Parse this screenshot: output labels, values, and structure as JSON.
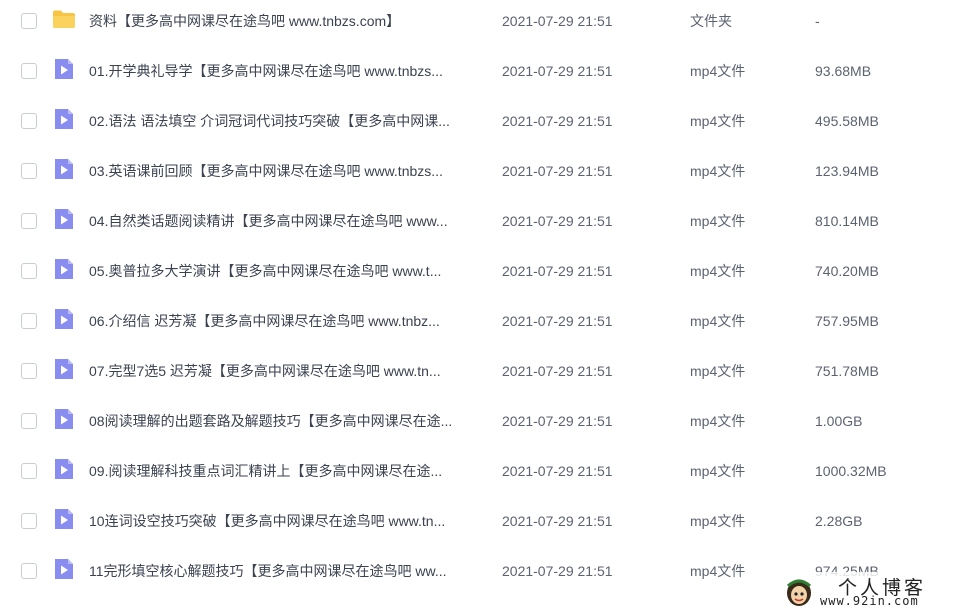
{
  "colors": {
    "folder": "#f7c443",
    "video": "#8a8df0",
    "text": "#3b4250",
    "muted": "#5c6370"
  },
  "files": [
    {
      "name": "资料【更多高中网课尽在途鸟吧 www.tnbzs.com】",
      "date": "2021-07-29 21:51",
      "type": "文件夹",
      "size": "-",
      "icon": "folder-icon"
    },
    {
      "name": "01.开学典礼导学【更多高中网课尽在途鸟吧 www.tnbzs...",
      "date": "2021-07-29 21:51",
      "type": "mp4文件",
      "size": "93.68MB",
      "icon": "video-file-icon"
    },
    {
      "name": "02.语法 语法填空 介词冠词代词技巧突破【更多高中网课...",
      "date": "2021-07-29 21:51",
      "type": "mp4文件",
      "size": "495.58MB",
      "icon": "video-file-icon"
    },
    {
      "name": "03.英语课前回顾【更多高中网课尽在途鸟吧 www.tnbzs...",
      "date": "2021-07-29 21:51",
      "type": "mp4文件",
      "size": "123.94MB",
      "icon": "video-file-icon"
    },
    {
      "name": "04.自然类话题阅读精讲【更多高中网课尽在途鸟吧 www...",
      "date": "2021-07-29 21:51",
      "type": "mp4文件",
      "size": "810.14MB",
      "icon": "video-file-icon"
    },
    {
      "name": "05.奥普拉多大学演讲【更多高中网课尽在途鸟吧 www.t...",
      "date": "2021-07-29 21:51",
      "type": "mp4文件",
      "size": "740.20MB",
      "icon": "video-file-icon"
    },
    {
      "name": "06.介绍信 迟芳凝【更多高中网课尽在途鸟吧 www.tnbz...",
      "date": "2021-07-29 21:51",
      "type": "mp4文件",
      "size": "757.95MB",
      "icon": "video-file-icon"
    },
    {
      "name": "07.完型7选5 迟芳凝【更多高中网课尽在途鸟吧 www.tn...",
      "date": "2021-07-29 21:51",
      "type": "mp4文件",
      "size": "751.78MB",
      "icon": "video-file-icon"
    },
    {
      "name": "08阅读理解的出题套路及解题技巧【更多高中网课尽在途...",
      "date": "2021-07-29 21:51",
      "type": "mp4文件",
      "size": "1.00GB",
      "icon": "video-file-icon"
    },
    {
      "name": "09.阅读理解科技重点词汇精讲上【更多高中网课尽在途...",
      "date": "2021-07-29 21:51",
      "type": "mp4文件",
      "size": "1000.32MB",
      "icon": "video-file-icon"
    },
    {
      "name": "10连词设空技巧突破【更多高中网课尽在途鸟吧 www.tn...",
      "date": "2021-07-29 21:51",
      "type": "mp4文件",
      "size": "2.28GB",
      "icon": "video-file-icon"
    },
    {
      "name": "11完形填空核心解题技巧【更多高中网课尽在途鸟吧 ww...",
      "date": "2021-07-29 21:51",
      "type": "mp4文件",
      "size": "974.25MB",
      "icon": "video-file-icon"
    }
  ],
  "watermark": {
    "title": "个人博客",
    "url": "www.92in.com"
  }
}
